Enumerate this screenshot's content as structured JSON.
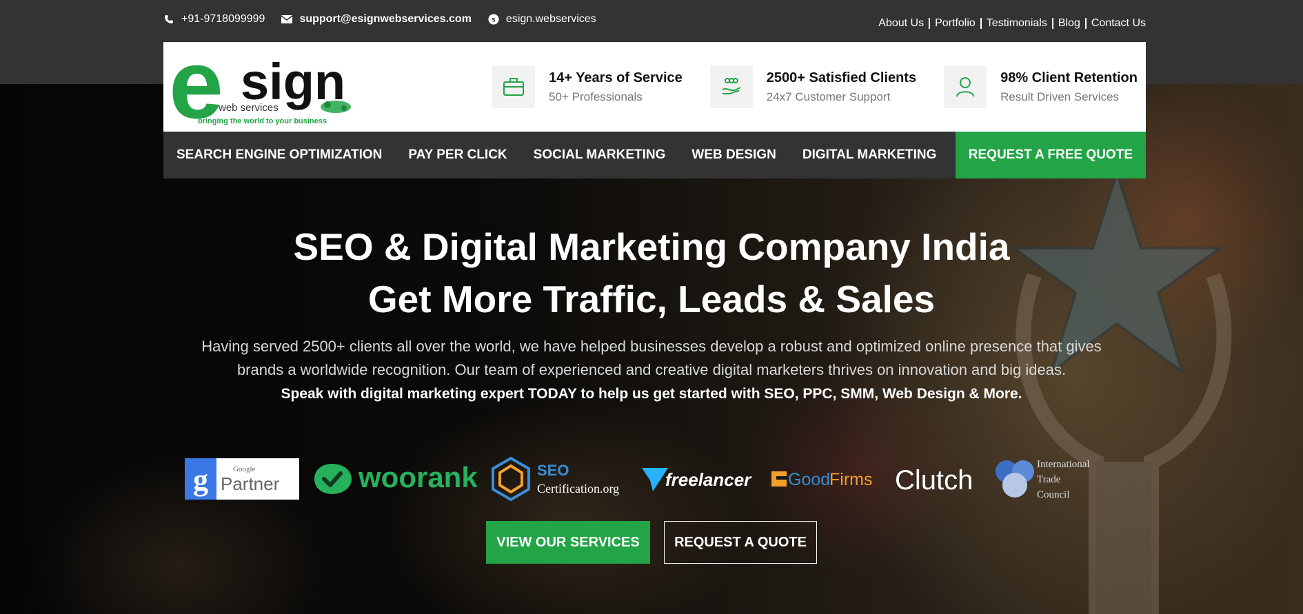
{
  "topbar": {
    "phone": "+91-9718099999",
    "email": "support@esignwebservices.com",
    "skype": "esign.webservices",
    "links": [
      "About Us",
      "Portfolio",
      "Testimonials",
      "Blog",
      "Contact Us"
    ]
  },
  "logo": {
    "wordmark_e": "e",
    "wordmark_rest": "sign",
    "subtitle": "web services",
    "tagline": "bringing the world to your business"
  },
  "features": [
    {
      "icon": "briefcase-icon",
      "title": "14+ Years of Service",
      "subtitle": "50+ Professionals"
    },
    {
      "icon": "handshake-icon",
      "title": "2500+ Satisfied Clients",
      "subtitle": "24x7 Customer Support"
    },
    {
      "icon": "user-icon",
      "title": "98% Client Retention",
      "subtitle": "Result Driven Services"
    }
  ],
  "nav": {
    "items": [
      "SEARCH ENGINE OPTIMIZATION",
      "PAY PER CLICK",
      "SOCIAL MARKETING",
      "WEB DESIGN",
      "DIGITAL MARKETING"
    ],
    "cta": "REQUEST A FREE QUOTE"
  },
  "hero": {
    "title_line1": "SEO & Digital Marketing Company India",
    "title_line2": "Get More Traffic, Leads & Sales",
    "desc_line1": "Having served 2500+ clients all over the world, we have helped businesses develop a robust and optimized online presence that gives",
    "desc_line2": "brands a worldwide recognition. Our team of experienced and creative digital marketers thrives on innovation and big ideas.",
    "callout": "Speak with digital marketing expert TODAY to help us get started with SEO, PPC, SMM, Web Design & More."
  },
  "badges": {
    "google_small": "Google",
    "google_big": "Partner",
    "woorank": "woorank",
    "seo_top": "SEO",
    "seo_bottom": "Certification.org",
    "freelancer": "freelancer",
    "goodfirms_a": "Good",
    "goodfirms_b": "Firms",
    "clutch": "Clutch",
    "itc_1": "International",
    "itc_2": "Trade",
    "itc_3": "Council"
  },
  "buttons": {
    "primary": "VIEW OUR SERVICES",
    "secondary": "REQUEST A QUOTE"
  },
  "colors": {
    "accent": "#22a447",
    "dark": "#333333"
  }
}
